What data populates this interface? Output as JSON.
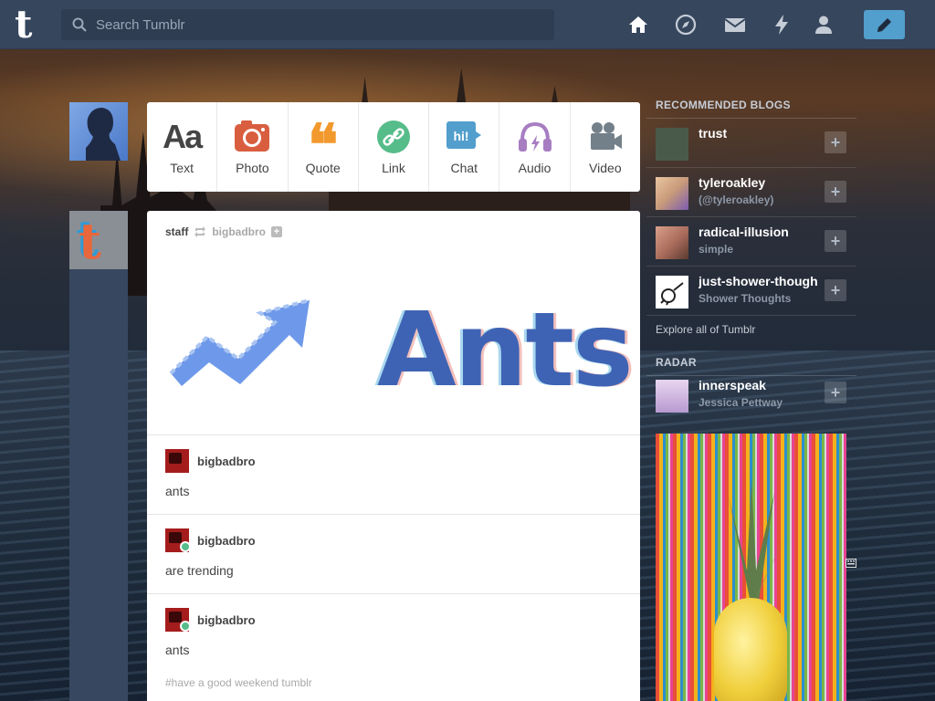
{
  "app": {
    "logo_letter": "t",
    "search_placeholder": "Search Tumblr",
    "nav_icons": [
      "home-icon",
      "compass-icon",
      "mail-icon",
      "lightning-icon",
      "person-icon"
    ],
    "compose_icon": "pencil-icon",
    "accent_color": "#529ecc",
    "bar_color": "#36465d"
  },
  "post_types": [
    {
      "label": "Text",
      "icon": "text-icon",
      "color": "#444444"
    },
    {
      "label": "Photo",
      "icon": "camera-icon",
      "color": "#d95e40"
    },
    {
      "label": "Quote",
      "icon": "quote-icon",
      "color": "#f2992e"
    },
    {
      "label": "Link",
      "icon": "link-icon",
      "color": "#56bc8a"
    },
    {
      "label": "Chat",
      "icon": "chat-icon",
      "color": "#529ecc"
    },
    {
      "label": "Audio",
      "icon": "headphones-icon",
      "color": "#a77dc2"
    },
    {
      "label": "Video",
      "icon": "video-camera-icon",
      "color": "#748089"
    }
  ],
  "post": {
    "author": "staff",
    "reblogged_from": "bigbadbro",
    "image_text": "Ants",
    "text_icon_glyph": "Aa",
    "chat_icon_text": "hi!",
    "quote_glyph": "❝",
    "replies": [
      {
        "user": "bigbadbro",
        "text": "ants",
        "reblog": false
      },
      {
        "user": "bigbadbro",
        "text": "are trending",
        "reblog": true
      },
      {
        "user": "bigbadbro",
        "text": "ants",
        "reblog": true
      }
    ],
    "tags": "#have a good weekend tumblr"
  },
  "sidebar": {
    "recommended_heading": "RECOMMENDED BLOGS",
    "blogs": [
      {
        "name": "trust",
        "sub": "",
        "avatar_color": "#4a5a4a"
      },
      {
        "name": "tyleroakley",
        "sub": "(@tyleroakley)",
        "avatar_color": "#c89a7a"
      },
      {
        "name": "radical-illusion",
        "sub": "simple",
        "avatar_color": "#a86a5a"
      },
      {
        "name": "just-shower-thoughts",
        "sub": "Shower Thoughts",
        "avatar_color": "#ffffff"
      }
    ],
    "explore_label": "Explore all of Tumblr",
    "radar_heading": "RADAR",
    "radar": {
      "name": "innerspeak",
      "sub": "Jessica Pettway",
      "avatar_color": "#b79ad0"
    },
    "follow_glyph": "+"
  }
}
